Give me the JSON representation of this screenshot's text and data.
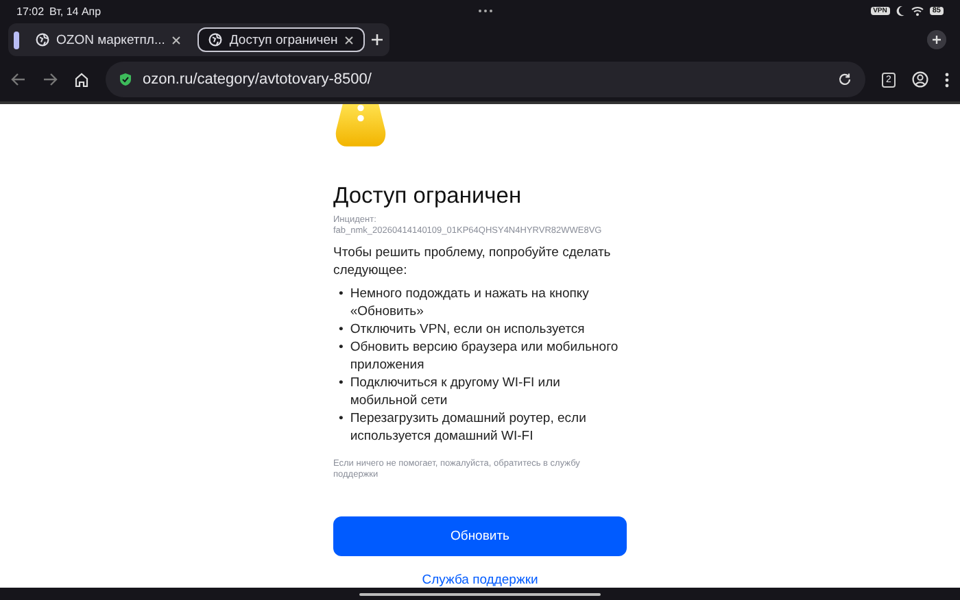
{
  "status_bar": {
    "time": "17:02",
    "date": "Вт, 14 Апр",
    "vpn": "VPN",
    "battery": "85"
  },
  "tabs": [
    {
      "title": "OZON маркетпл...",
      "selected": false
    },
    {
      "title": "Доступ ограничен",
      "selected": true
    }
  ],
  "address_bar": {
    "url": "ozon.ru/category/avtotovary-8500/",
    "tab_count": "2"
  },
  "page": {
    "title": "Доступ ограничен",
    "incident_label": "Инцидент:",
    "incident_id": "fab_nmk_20260414140109_01KP64QHSY4N4HYRVR82WWE8VG",
    "intro": "Чтобы решить проблему, попробуйте сделать следующее:",
    "steps": [
      {
        "bullet": "•",
        "text": "Немного подождать и нажать на кнопку «Обновить»"
      },
      {
        "bullet": "•",
        "text": "Отключить VPN, если он используется"
      },
      {
        "bullet": "•",
        "text": "Обновить версию браузера или мобильного приложения"
      },
      {
        "bullet": "•",
        "text": "Подключиться к другому WI-FI или мобильной сети"
      },
      {
        "bullet": "•",
        "text": "Перезагрузить домашний роутер, если используется домашний WI-FI"
      }
    ],
    "note": "Если ничего не помогает, пожалуйста, обратитесь в службу поддержки",
    "button": "Обновить",
    "link": "Служба поддержки"
  }
}
